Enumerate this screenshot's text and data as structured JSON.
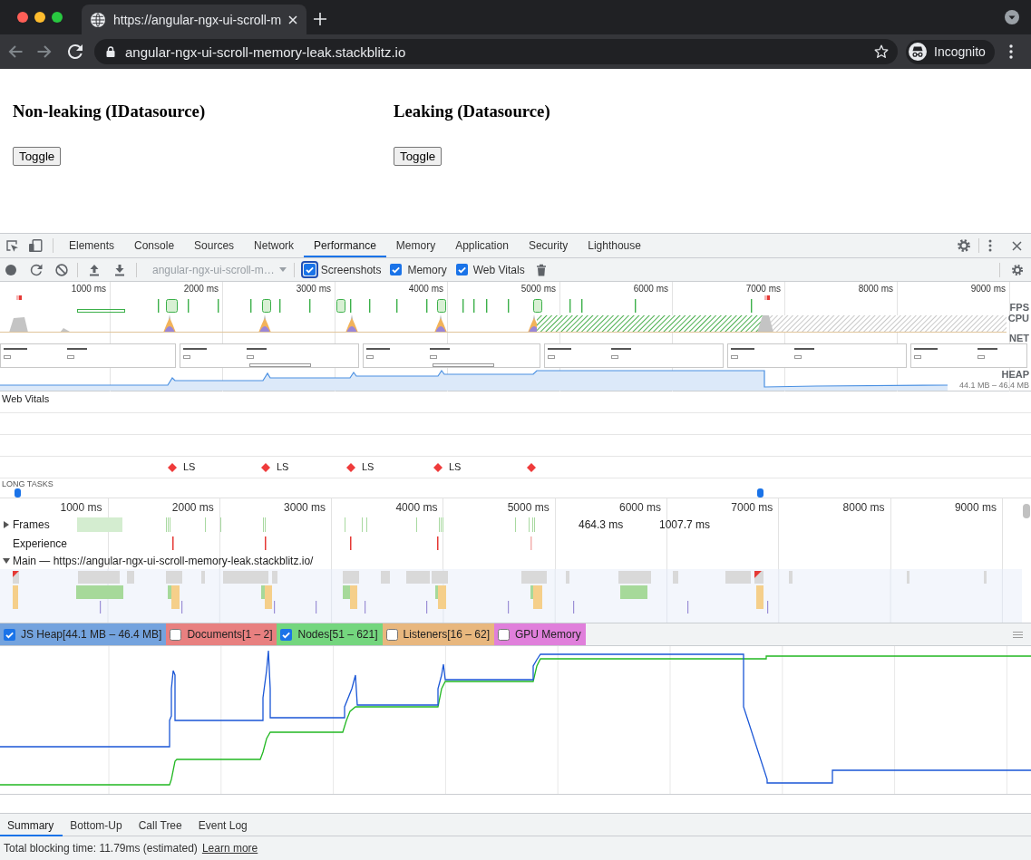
{
  "browser": {
    "tab_title": "https://angular-ngx-ui-scroll-m",
    "back_disabled": true,
    "forward_disabled": true,
    "address": "angular-ngx-ui-scroll-memory-leak.stackblitz.io",
    "profile": "Incognito"
  },
  "page": {
    "panels": [
      {
        "heading": "Non-leaking (IDatasource)",
        "button": "Toggle"
      },
      {
        "heading": "Leaking (Datasource)",
        "button": "Toggle"
      }
    ]
  },
  "devtools": {
    "tabs": [
      {
        "label": "Elements",
        "selected": false
      },
      {
        "label": "Console",
        "selected": false
      },
      {
        "label": "Sources",
        "selected": false
      },
      {
        "label": "Network",
        "selected": false
      },
      {
        "label": "Performance",
        "selected": true
      },
      {
        "label": "Memory",
        "selected": false
      },
      {
        "label": "Application",
        "selected": false
      },
      {
        "label": "Security",
        "selected": false
      },
      {
        "label": "Lighthouse",
        "selected": false
      }
    ],
    "toolbar": {
      "recording": {
        "value": "angular-ngx-ui-scroll-m…",
        "disabled": true
      },
      "options": [
        {
          "label": "Screenshots",
          "checked": true,
          "focused": true
        },
        {
          "label": "Memory",
          "checked": true,
          "focused": false
        },
        {
          "label": "Web Vitals",
          "checked": true,
          "focused": false
        }
      ]
    },
    "overview": {
      "ticks": [
        "1000 ms",
        "2000 ms",
        "3000 ms",
        "4000 ms",
        "5000 ms",
        "6000 ms",
        "7000 ms",
        "8000 ms",
        "9000 ms"
      ],
      "fps_label": "FPS",
      "cpu_label": "CPU",
      "net_label": "NET",
      "heap_label": "HEAP",
      "heap_range": "44.1 MB – 46.4 MB"
    },
    "web_vitals": {
      "title": "Web Vitals",
      "markers": [
        {
          "kind": "labeled",
          "label": "LS"
        },
        {
          "kind": "labeled",
          "label": "LS"
        },
        {
          "kind": "labeled",
          "label": "LS"
        },
        {
          "kind": "labeled",
          "label": "LS"
        },
        {
          "kind": "bare"
        }
      ]
    },
    "long_tasks": {
      "title": "LONG TASKS"
    },
    "timeline": {
      "ticks": [
        "1000 ms",
        "2000 ms",
        "3000 ms",
        "4000 ms",
        "5000 ms",
        "6000 ms",
        "7000 ms",
        "8000 ms",
        "9000 ms"
      ],
      "tracks": [
        {
          "kind": "frames",
          "label": "Frames",
          "expanded": false,
          "durations": [
            "464.3 ms",
            "1007.7 ms"
          ]
        },
        {
          "kind": "experience",
          "label": "Experience"
        },
        {
          "kind": "main",
          "label": "Main — https://angular-ngx-ui-scroll-memory-leak.stackblitz.io/",
          "expanded": true
        }
      ]
    },
    "counters": [
      {
        "label": "JS Heap[44.1 MB – 46.4 MB]",
        "checked": true,
        "color": "#74a3de"
      },
      {
        "label": "Documents[1 – 2]",
        "checked": false,
        "color": "#e88080"
      },
      {
        "label": "Nodes[51 – 621]",
        "checked": true,
        "color": "#74d67e"
      },
      {
        "label": "Listeners[16 – 62]",
        "checked": false,
        "color": "#e8b77e"
      },
      {
        "label": "GPU Memory",
        "checked": false,
        "color": "#e07fdb"
      }
    ],
    "bottom_tabs": [
      {
        "label": "Summary",
        "selected": true
      },
      {
        "label": "Bottom-Up",
        "selected": false
      },
      {
        "label": "Call Tree",
        "selected": false
      },
      {
        "label": "Event Log",
        "selected": false
      }
    ],
    "summary": {
      "text": "Total blocking time: 11.79ms (estimated)",
      "link": "Learn more"
    }
  }
}
